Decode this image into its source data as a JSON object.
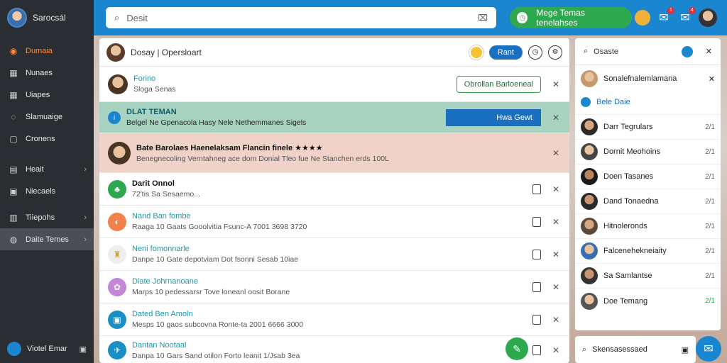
{
  "sidebar": {
    "user_name": "Sarocsál",
    "items": [
      {
        "label": "Dumaia",
        "icon": "home-icon"
      },
      {
        "label": "Nunaes",
        "icon": "grid-icon"
      },
      {
        "label": "Uiapes",
        "icon": "grid-icon"
      },
      {
        "label": "Slamuaige",
        "icon": "chat-icon"
      },
      {
        "label": "Cronens",
        "icon": "square-icon"
      },
      {
        "label": "Heait",
        "icon": "folder-icon",
        "chevron": "›"
      },
      {
        "label": "Niecaels",
        "icon": "inbox-icon"
      },
      {
        "label": "Tiiepohs",
        "icon": "bell-icon",
        "chevron": "›"
      },
      {
        "label": "Daite Temes",
        "icon": "globe-icon",
        "chevron": "›"
      }
    ],
    "footer_label": "Viotel Emar"
  },
  "topbar": {
    "search_placeholder": "Desit",
    "cta_label": "Mege Temas tenelahses",
    "notif_badge_1": "1",
    "notif_badge_2": "4"
  },
  "main": {
    "header_title": "Dosay  |  Opersloart",
    "header_button": "Rant",
    "rows": [
      {
        "name": "Forino",
        "sub": "Sloga Senas",
        "button": "Obrollan Barloeneal"
      },
      {
        "name": "DLAT TEMAN",
        "sub": "Belgel Ne Gpenacola Hasy   Nele Nethemmanes Sigels",
        "button": "Hwa Gewt"
      },
      {
        "name": "Bate Barolaes   Haenelaksam Flancin finele ★★★★",
        "sub": "Benegnecoling   Verntahneg ace dom   Donial   Tleo fue Ne Stanchen erds 100L"
      },
      {
        "name": "Darit Onnol",
        "sub": "72'tis Sa Sesaemo..."
      },
      {
        "name": "Nand Ban fombe",
        "sub": "Raaga 10 Gaats Gooolvitia  Fsunc-A 7001 3698  3720"
      },
      {
        "name": "Neni fomonnarle",
        "sub": "Danpe 10 Gate depotviam   Dot   fsonni Sesab 10iae"
      },
      {
        "name": "Diate Johrnanoane",
        "sub": "Marps 10 pedessarsr   Tove loneanl   oosit Borane"
      },
      {
        "name": "Dated Ben Amoln",
        "sub": "Mesps 10 gaos subcovna  Ronte-ta 2001 6666  3000"
      },
      {
        "name": "Dantan Nootaal",
        "sub": "Danpa 10 Gars Sand otilon  Forto leanit 1/Jsab 3ea"
      }
    ]
  },
  "rpanel": {
    "search_placeholder": "Osaste",
    "rows": [
      {
        "name": "Sonalefnalemlamana",
        "time": ""
      },
      {
        "name": "Bele   Daie",
        "time": ""
      },
      {
        "name": "Darr Tegrulars",
        "time": "2/1"
      },
      {
        "name": "Dornit Meohoins",
        "time": "2/1"
      },
      {
        "name": "Doen Tasanes",
        "time": "2/1"
      },
      {
        "name": "Dand Tonaedna",
        "time": "2/1"
      },
      {
        "name": "Hitnoleronds",
        "time": "2/1"
      },
      {
        "name": "Falcenehekneiaity",
        "time": "2/1"
      },
      {
        "name": "Sa Samlantse",
        "time": "2/1"
      },
      {
        "name": "Doe Temang",
        "time": "2/1"
      }
    ],
    "bottom_placeholder": "Skensasessaed"
  },
  "colors": {
    "topbar": "#1a86d0",
    "sidebar": "#2a2d31",
    "green": "#2ea84e",
    "teal_row": "#a9d3c1",
    "pink_row": "#f0d2c9"
  }
}
